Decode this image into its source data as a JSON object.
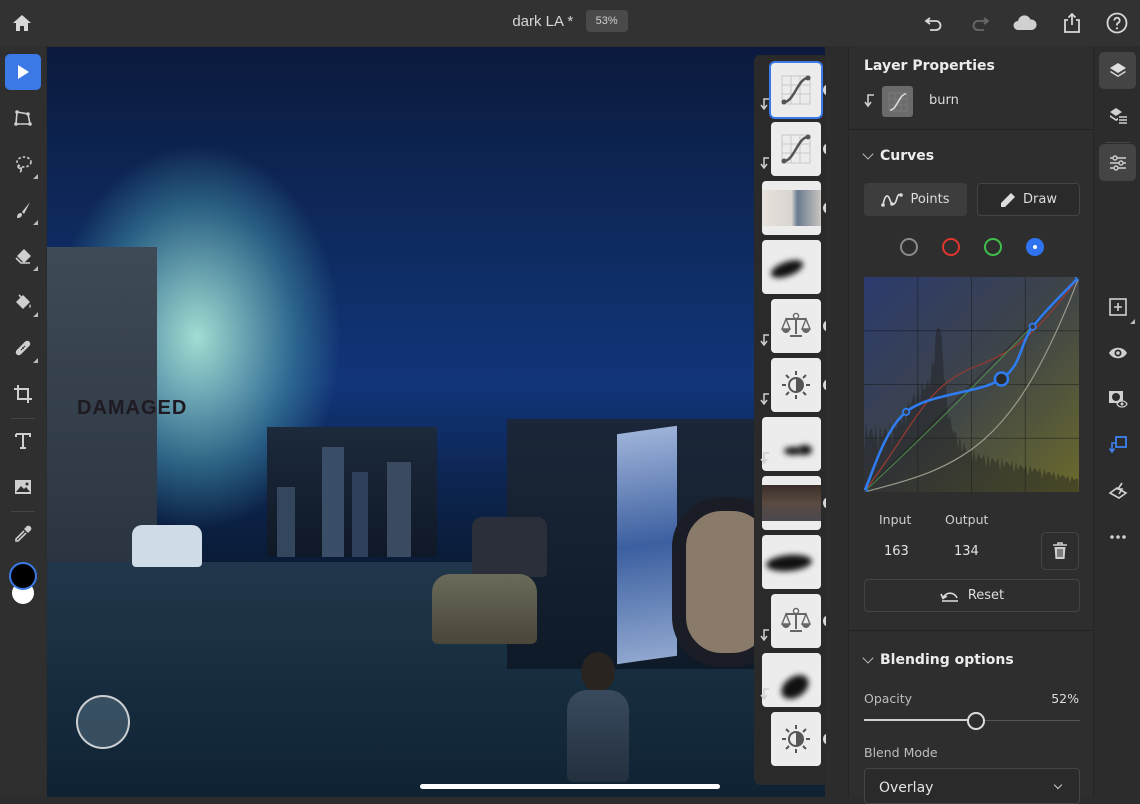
{
  "topbar": {
    "home_icon": "home-icon",
    "document_title": "dark LA *",
    "zoom_level": "53%",
    "actions": [
      {
        "name": "undo",
        "icon": "undo-icon",
        "enabled": true
      },
      {
        "name": "redo",
        "icon": "redo-icon",
        "enabled": false
      },
      {
        "name": "cloud",
        "icon": "cloud-icon",
        "enabled": true
      },
      {
        "name": "share",
        "icon": "share-icon",
        "enabled": true
      },
      {
        "name": "help",
        "icon": "help-icon",
        "enabled": true
      }
    ]
  },
  "toolbar": {
    "tools": [
      {
        "name": "select",
        "icon": "select-arrow-icon",
        "active": true,
        "has_submenu": false
      },
      {
        "name": "transform",
        "icon": "transform-icon",
        "active": false,
        "has_submenu": false
      },
      {
        "name": "lasso",
        "icon": "lasso-icon",
        "active": false,
        "has_submenu": true
      },
      {
        "name": "brush",
        "icon": "brush-icon",
        "active": false,
        "has_submenu": true
      },
      {
        "name": "eraser",
        "icon": "eraser-icon",
        "active": false,
        "has_submenu": true
      },
      {
        "name": "fill",
        "icon": "paint-bucket-icon",
        "active": false,
        "has_submenu": true
      },
      {
        "name": "healing",
        "icon": "bandage-icon",
        "active": false,
        "has_submenu": true
      },
      {
        "name": "crop",
        "icon": "crop-icon",
        "active": false,
        "has_submenu": false
      },
      {
        "name": "type",
        "icon": "type-icon",
        "active": false,
        "has_submenu": false
      },
      {
        "name": "place-image",
        "icon": "image-icon",
        "active": false,
        "has_submenu": false
      },
      {
        "name": "eyedropper",
        "icon": "eyedropper-icon",
        "active": false,
        "has_submenu": false
      }
    ],
    "foreground_color": "#000000",
    "background_color": "#ffffff"
  },
  "canvas": {
    "description": "Composite night photo of a Los Angeles alley with a child sitting in the street",
    "wall_sign_text": "DAMAGED"
  },
  "layers": [
    {
      "type": "curves",
      "icon": "curves-icon",
      "selected": true,
      "clipped": true,
      "visible": true
    },
    {
      "type": "curves",
      "icon": "curves-icon",
      "selected": false,
      "clipped": true,
      "visible": true
    },
    {
      "type": "photo",
      "icon": "photo-thumbnail",
      "selected": false,
      "clipped": false,
      "visible": true
    },
    {
      "type": "mask",
      "icon": "mask-thumbnail",
      "selected": false,
      "clipped": false,
      "visible": false
    },
    {
      "type": "color-balance",
      "icon": "balance-scale-icon",
      "selected": false,
      "clipped": true,
      "visible": true
    },
    {
      "type": "brightness-contrast",
      "icon": "brightness-icon",
      "selected": false,
      "clipped": true,
      "visible": true
    },
    {
      "type": "mask",
      "icon": "mask-thumbnail",
      "selected": false,
      "clipped": true,
      "visible": false
    },
    {
      "type": "photo",
      "icon": "photo-thumbnail",
      "selected": false,
      "clipped": false,
      "visible": true
    },
    {
      "type": "mask",
      "icon": "mask-thumbnail",
      "selected": false,
      "clipped": false,
      "visible": false
    },
    {
      "type": "color-balance",
      "icon": "balance-scale-icon",
      "selected": false,
      "clipped": true,
      "visible": true
    },
    {
      "type": "mask",
      "icon": "mask-thumbnail",
      "selected": false,
      "clipped": true,
      "visible": false
    },
    {
      "type": "brightness-contrast",
      "icon": "brightness-icon",
      "selected": false,
      "clipped": false,
      "visible": true
    }
  ],
  "properties": {
    "title": "Layer Properties",
    "layer_name": "burn",
    "curves": {
      "section_label": "Curves",
      "mode_points": "Points",
      "mode_draw": "Draw",
      "active_mode": "Points",
      "channels": [
        {
          "name": "rgb",
          "color": "#8a8a8a",
          "active": false
        },
        {
          "name": "red",
          "color": "#e0352b",
          "active": false
        },
        {
          "name": "green",
          "color": "#3fbf4a",
          "active": false
        },
        {
          "name": "blue",
          "color": "#2f73f0",
          "active": true
        }
      ],
      "blue_curve_points": [
        [
          0,
          0
        ],
        [
          50,
          95
        ],
        [
          163,
          134
        ],
        [
          200,
          196
        ],
        [
          255,
          255
        ]
      ],
      "selected_point_index": 2,
      "input_label": "Input",
      "output_label": "Output",
      "input_value": "163",
      "output_value": "134",
      "reset_label": "Reset"
    },
    "blending": {
      "section_label": "Blending options",
      "opacity_label": "Opacity",
      "opacity_value": "52%",
      "opacity_fraction": 0.52,
      "blend_mode_label": "Blend Mode",
      "blend_mode_value": "Overlay"
    }
  },
  "right_rail": {
    "buttons": [
      {
        "name": "layers",
        "icon": "layers-icon",
        "active": true
      },
      {
        "name": "layer-list",
        "icon": "layers-list-icon",
        "active": false
      },
      {
        "name": "adjustments",
        "icon": "sliders-icon",
        "active": true
      },
      {
        "name": "add-layer",
        "icon": "add-layer-icon",
        "active": false
      },
      {
        "name": "visibility",
        "icon": "eye-icon",
        "active": false
      },
      {
        "name": "mask",
        "icon": "mask-visibility-icon",
        "active": false
      },
      {
        "name": "clipping",
        "icon": "clip-layer-icon",
        "active": false
      },
      {
        "name": "merge",
        "icon": "merge-layers-icon",
        "active": false
      },
      {
        "name": "more",
        "icon": "more-icon",
        "active": false
      }
    ]
  }
}
